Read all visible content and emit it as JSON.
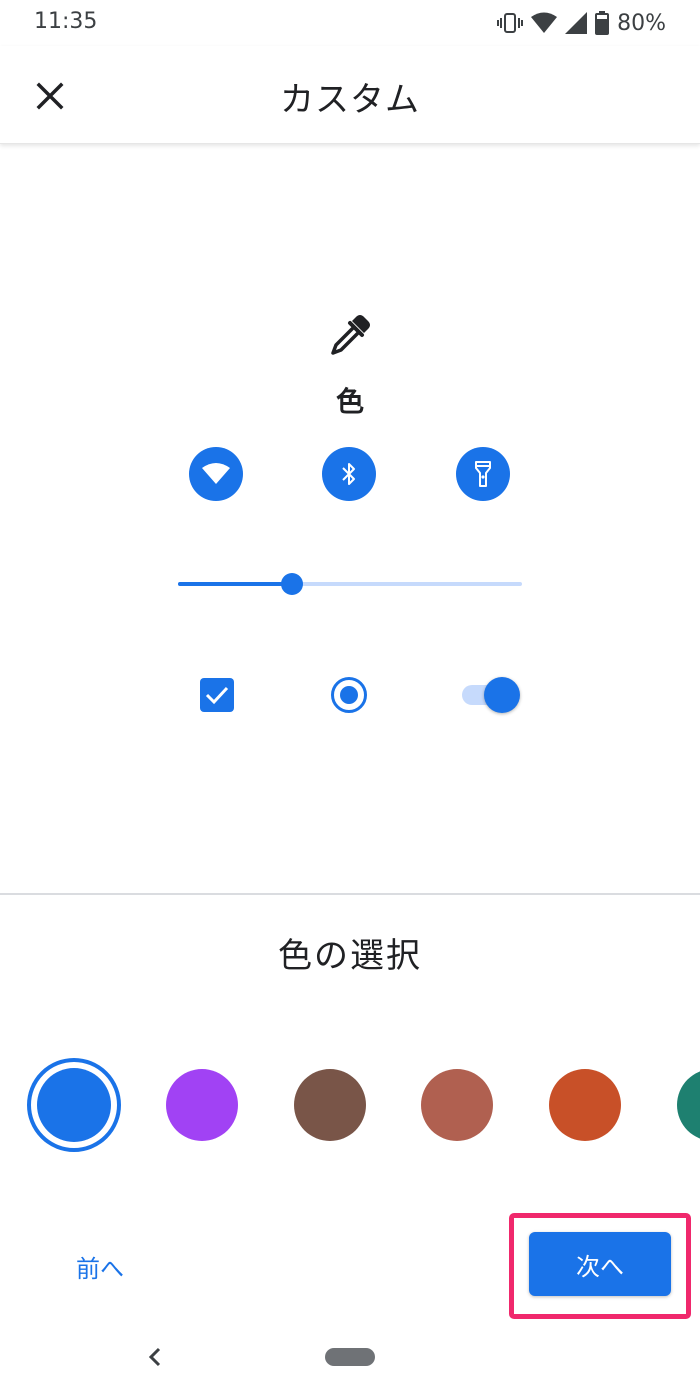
{
  "status_bar": {
    "time": "11:35",
    "battery": "80%",
    "icons": [
      "vibrate-icon",
      "wifi-signal-icon",
      "cell-signal-icon",
      "battery-icon"
    ]
  },
  "app_bar": {
    "title": "カスタム",
    "close_icon": "close-icon"
  },
  "preview": {
    "icon": "eyedropper-icon",
    "label": "色",
    "quick_settings": [
      "wifi-icon",
      "bluetooth-icon",
      "flashlight-icon"
    ],
    "slider_value": 0.33,
    "checkbox_checked": true,
    "radio_selected": true,
    "toggle_on": true
  },
  "color_selection": {
    "title": "色の選択",
    "swatches": [
      {
        "name": "blue",
        "color": "#1a73e8",
        "selected": true
      },
      {
        "name": "purple",
        "color": "#a142f4",
        "selected": false
      },
      {
        "name": "brown",
        "color": "#795548",
        "selected": false
      },
      {
        "name": "terracotta",
        "color": "#b06050",
        "selected": false
      },
      {
        "name": "orange",
        "color": "#c85028",
        "selected": false
      },
      {
        "name": "teal",
        "color": "#1e8070",
        "selected": false
      }
    ]
  },
  "footer": {
    "prev_label": "前へ",
    "next_label": "次へ",
    "highlight_color": "#f0286c"
  },
  "colors": {
    "accent": "#1a73e8",
    "accent_light": "#c6dafc",
    "nav_pill": "#6f7276"
  }
}
